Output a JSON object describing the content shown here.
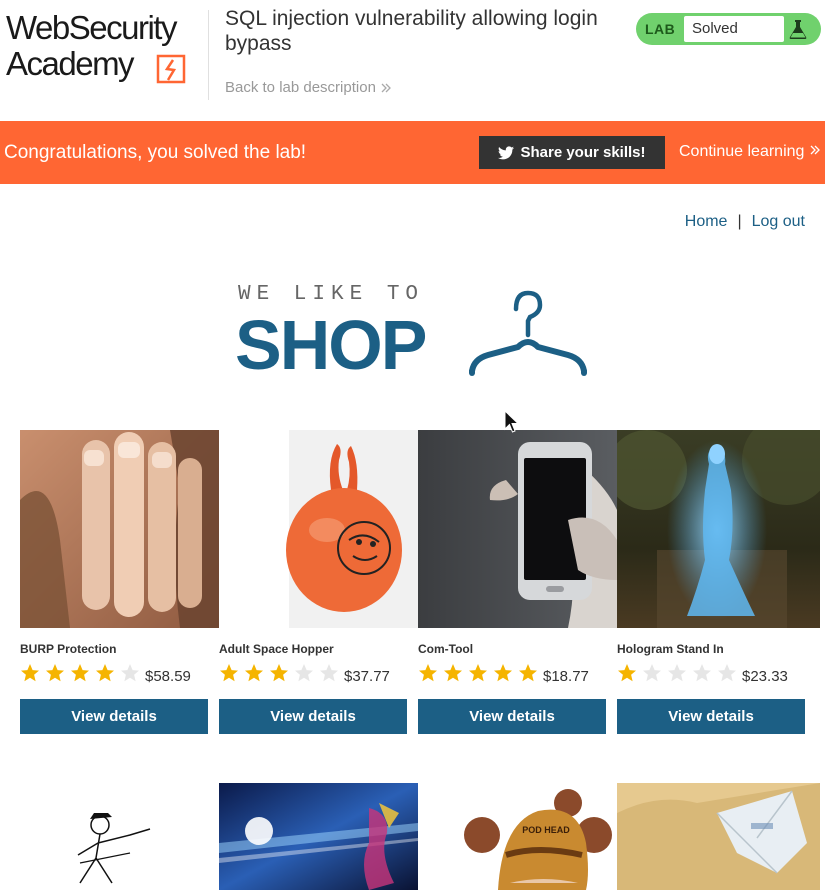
{
  "header": {
    "logo_line1": "WebSecurity",
    "logo_line2": "Academy",
    "lab_title": "SQL injection vulnerability allowing login bypass",
    "back_link": "Back to lab description",
    "lab_tag": "LAB",
    "lab_status": "Solved"
  },
  "banner": {
    "message": "Congratulations, you solved the lab!",
    "share_label": "Share your skills!",
    "continue_label": "Continue learning"
  },
  "nav": {
    "home": "Home",
    "separator": "|",
    "logout": "Log out"
  },
  "hero": {
    "tagline": "WE LIKE TO",
    "title": "SHOP"
  },
  "colors": {
    "accent_orange": "#ff6633",
    "brand_blue": "#1c5f85",
    "solved_green": "#70d16d",
    "star_gold": "#f5b400",
    "star_empty": "#e6e6e6"
  },
  "products": [
    {
      "name": "BURP Protection",
      "rating": 4,
      "price": "$58.59",
      "button": "View details"
    },
    {
      "name": "Adult Space Hopper",
      "rating": 3,
      "price": "$37.77",
      "button": "View details"
    },
    {
      "name": "Com-Tool",
      "rating": 5,
      "price": "$18.77",
      "button": "View details"
    },
    {
      "name": "Hologram Stand In",
      "rating": 1,
      "price": "$23.33",
      "button": "View details"
    }
  ],
  "row2_products": [
    {
      "hat_text": "POD HEAD"
    }
  ]
}
